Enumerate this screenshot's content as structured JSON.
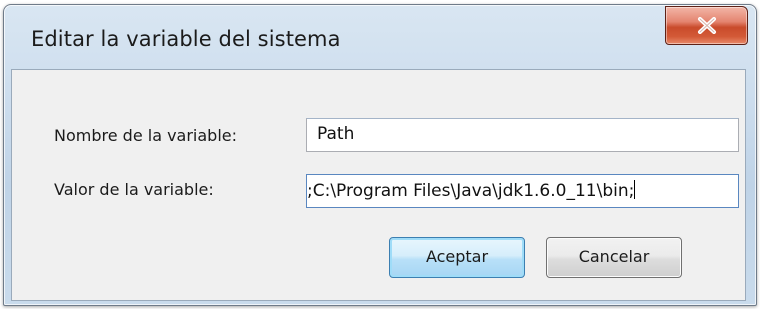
{
  "window": {
    "title": "Editar la variable del sistema"
  },
  "form": {
    "name_label": "Nombre de la variable:",
    "name_value": "Path",
    "value_label": "Valor de la variable:",
    "value_value": ";C:\\Program Files\\Java\\jdk1.6.0_11\\bin;"
  },
  "buttons": {
    "ok_label": "Aceptar",
    "cancel_label": "Cancelar"
  },
  "icons": {
    "close": "close-icon"
  },
  "colors": {
    "close_button": "#c94b2b",
    "default_button_border": "#3c7fb1",
    "focused_field_border": "#5a87c0"
  }
}
